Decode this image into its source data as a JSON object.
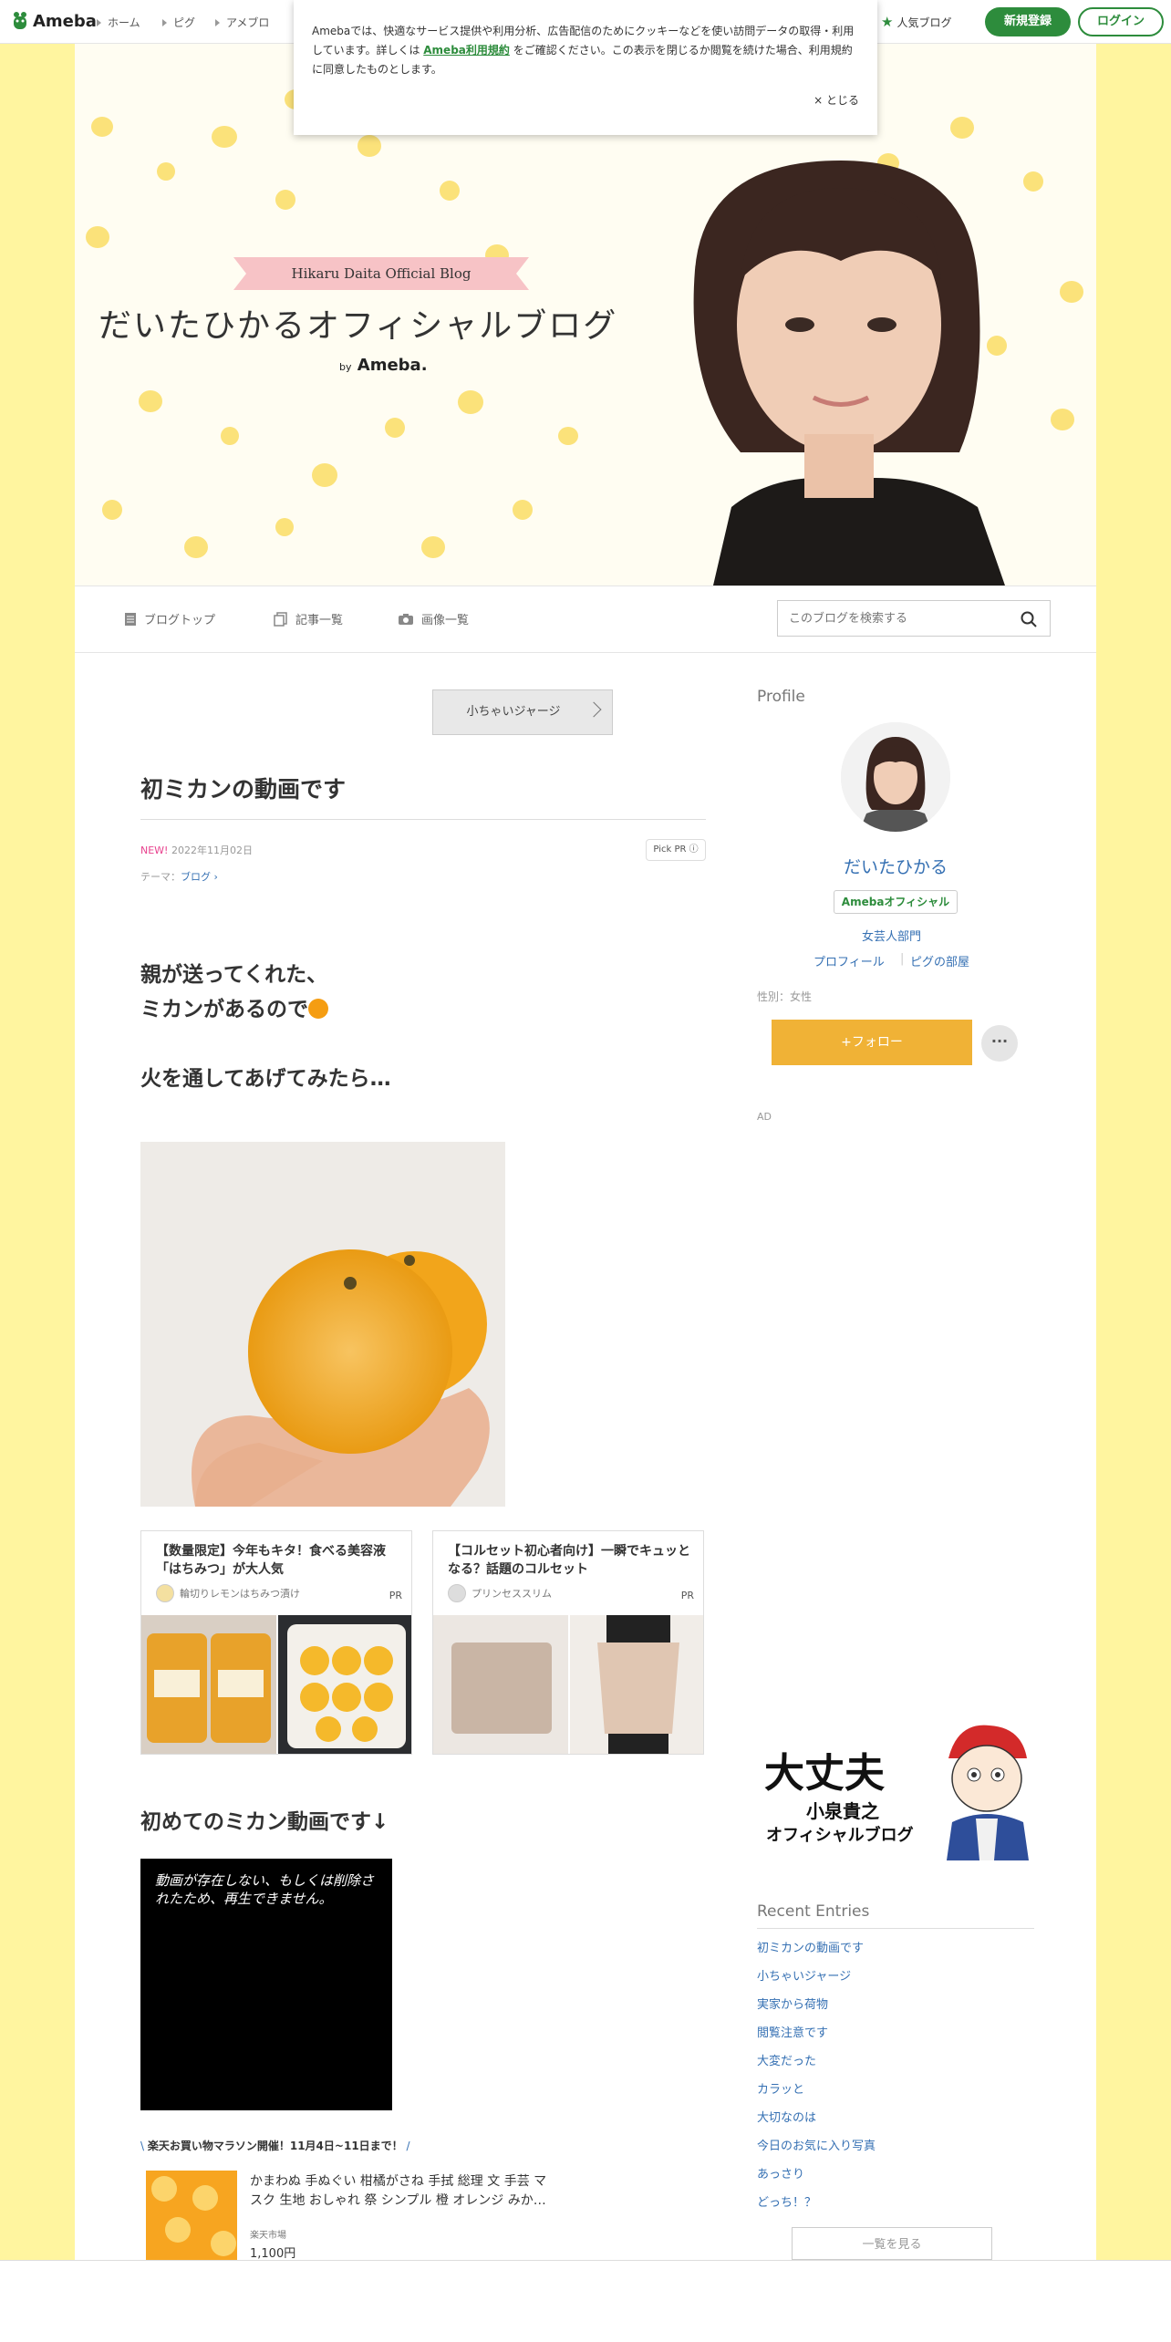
{
  "app": {
    "logo": "Ameba",
    "nav": [
      "ホーム",
      "ピグ",
      "アメブロ"
    ],
    "popular": "人気ブログ",
    "register": "新規登録",
    "login": "ログイン"
  },
  "cookie": {
    "text_before": "Amebaでは、快適なサービス提供や利用分析、広告配信のためにクッキーなどを使い訪問データの取得・利用しています。詳しくは ",
    "link": "Ameba利用規約",
    "text_after": " をご確認ください。この表示を閉じるか閲覧を続けた場合、利用規約に同意したものとします。",
    "close": "× とじる"
  },
  "header": {
    "ribbon": "Hikaru Daita Official Blog",
    "title": "だいたひかるオフィシャルブログ",
    "by": "by",
    "brand": "Ameba."
  },
  "subnav": {
    "top": "ブログトップ",
    "entries": "記事一覧",
    "images": "画像一覧",
    "search_placeholder": "このブログを検索する"
  },
  "article": {
    "prev": "小ちゃいジャージ",
    "title": "初ミカンの動画です",
    "new": "NEW!",
    "date": "2022年11月02日",
    "pickpr": "Pick PR ⓘ",
    "theme_label": "テーマ：",
    "theme": "ブログ",
    "line1": "親が送ってくれた、",
    "line2": "ミカンがあるので",
    "line3": "火を通してあげてみたら…",
    "subheading": "初めてのミカン動画です↓",
    "video_msg": "動画が存在しない、もしくは削除されたため、再生できません。"
  },
  "ads": [
    {
      "title": "【数量限定】今年もキタ！食べる美容液「はちみつ」が大人気",
      "source": "輪切りレモンはちみつ漬け",
      "pr": "PR"
    },
    {
      "title": "【コルセット初心者向け】一瞬でキュッとなる？話題のコルセット",
      "source": "プリンセススリム",
      "pr": "PR"
    }
  ],
  "rakuten": {
    "banner": "楽天お買い物マラソン開催！11月4日~11日まで！",
    "product_title": "かまわぬ 手ぬぐい 柑橘がさね 手拭 総理 文 手芸 マスク 生地 おしゃれ 祭 シンプル 橙 オレンジ みか…",
    "shop": "楽天市場",
    "price": "1,100円"
  },
  "sidebar": {
    "profile_heading": "Profile",
    "name": "だいたひかる",
    "official": "Amebaオフィシャル",
    "category": "女芸人部門",
    "profile_link": "プロフィール",
    "pig_link": "ピグの部屋",
    "gender": "性別：女性",
    "follow": "+フォロー",
    "more": "···",
    "ad": "AD",
    "recent_heading": "Recent Entries",
    "recent": [
      "初ミカンの動画です",
      "小ちゃいジャージ",
      "実家から荷物",
      "閲覧注意です",
      "大変だった",
      "カラッと",
      "大切なのは",
      "今日のお気に入り写真",
      "あっさり",
      "どっち！？"
    ],
    "view_all": "一覧を見る"
  },
  "banner_ad": {
    "big": "大丈夫",
    "name": "小泉貴之",
    "sub": "オフィシャルブログ"
  }
}
